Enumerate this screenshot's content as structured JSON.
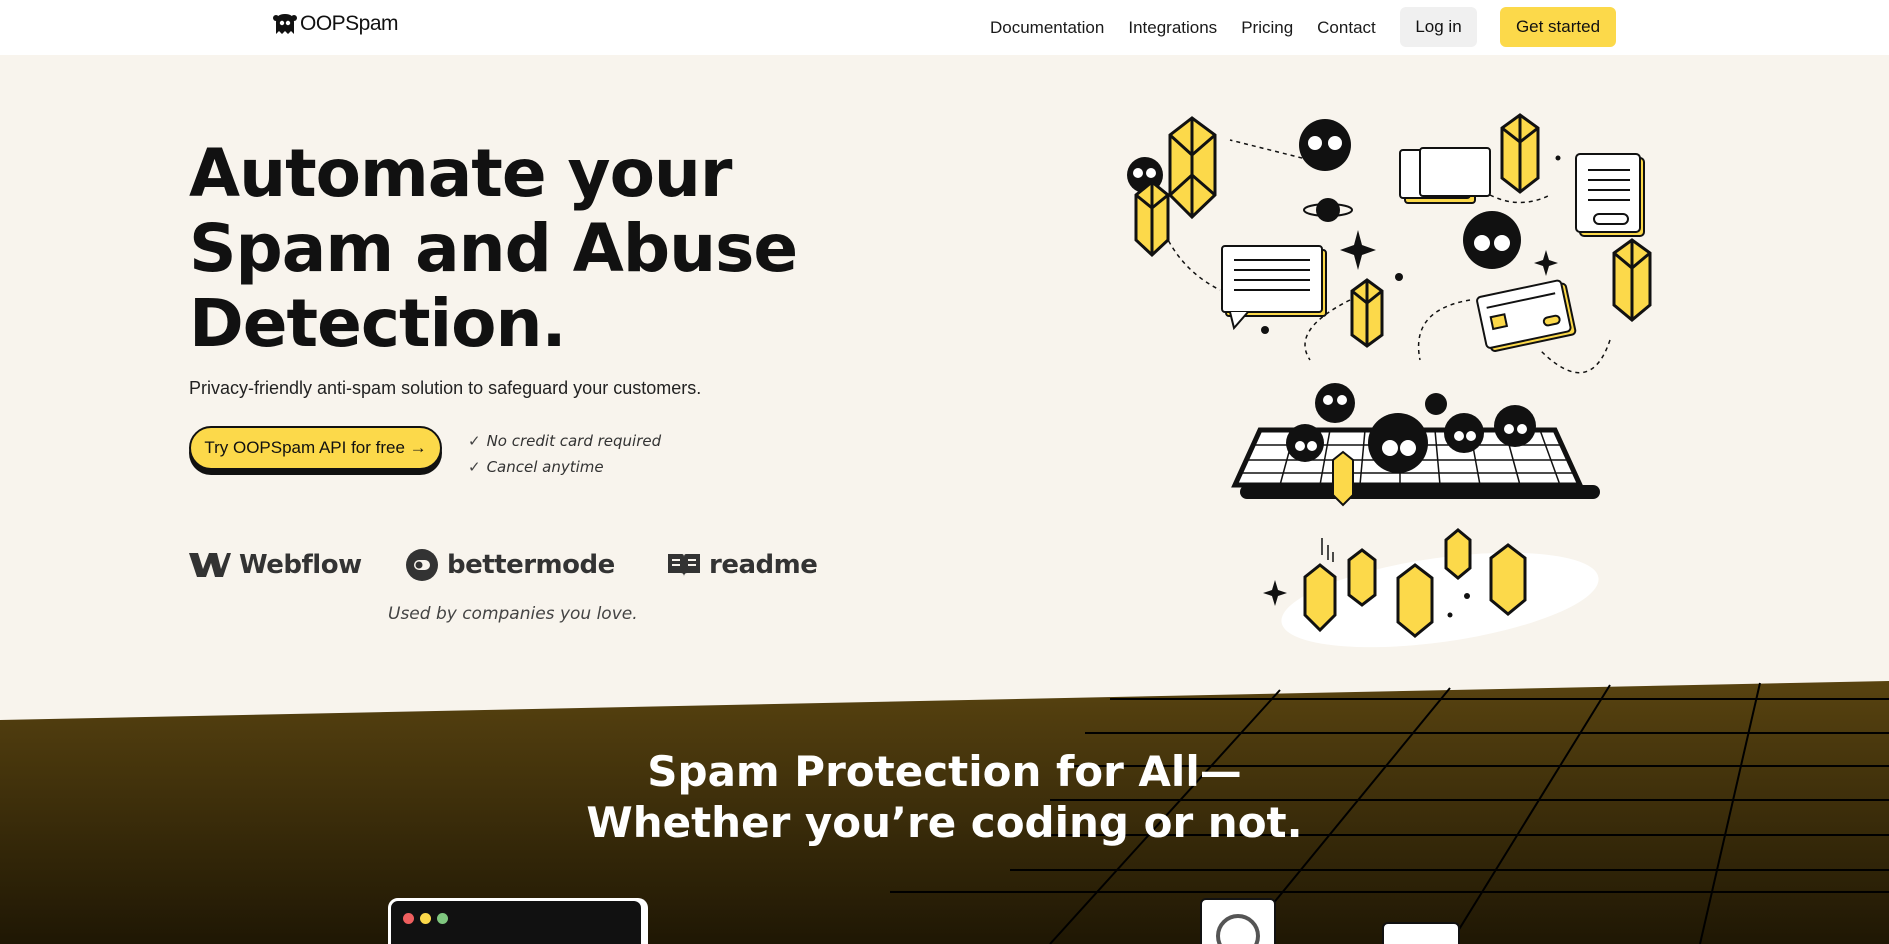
{
  "nav": {
    "logo_text": "OOPSpam",
    "links": [
      "Documentation",
      "Integrations",
      "Pricing",
      "Contact"
    ],
    "login_label": "Log in",
    "cta_label": "Get started"
  },
  "hero": {
    "title_line1": "Automate your",
    "title_line2": "Spam and Abuse",
    "title_line3": "Detection.",
    "subtitle": "Privacy-friendly anti-spam solution to safeguard your customers.",
    "cta_label": "Try OOPSpam API for free →",
    "checks": [
      "No credit card required",
      "Cancel anytime"
    ]
  },
  "companies": {
    "items": [
      "Webflow",
      "bettermode",
      "readme"
    ],
    "caption": "Used by companies you love."
  },
  "section2": {
    "title_line1": "Spam Protection for All—",
    "title_line2": "Whether you’re coding or not."
  },
  "colors": {
    "accent": "#fcd94a",
    "hero_bg": "#f8f4ed",
    "lower_bg_top": "#584310",
    "lower_bg_bottom": "#1f1704"
  },
  "icons": [
    "logo-ghost-icon",
    "check-icon",
    "webflow-logo-icon",
    "bettermode-logo-icon",
    "readme-logo-icon",
    "wordpress-icon"
  ]
}
